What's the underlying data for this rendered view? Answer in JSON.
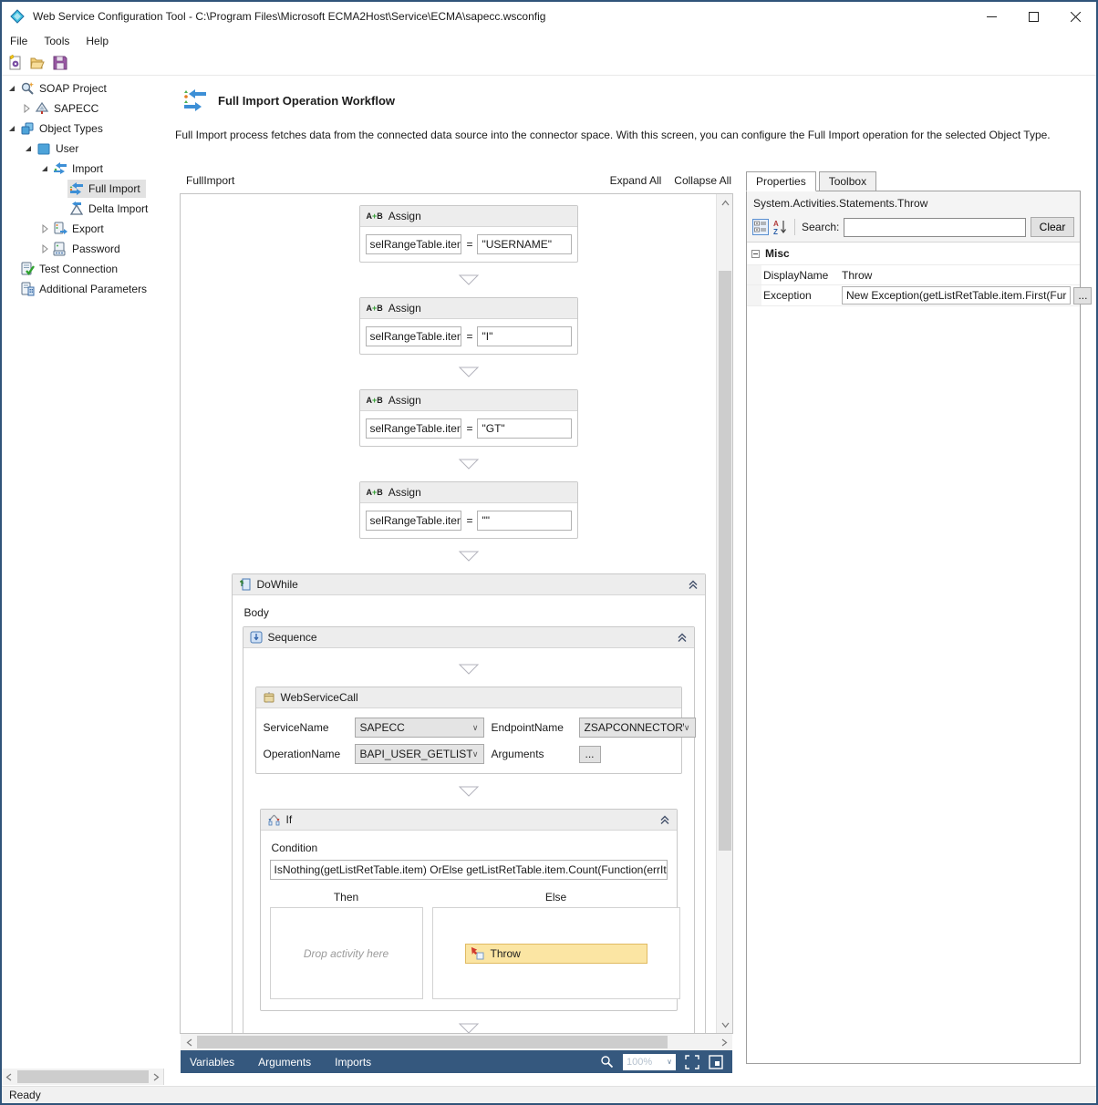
{
  "window": {
    "title": "Web Service Configuration Tool - C:\\Program Files\\Microsoft ECMA2Host\\Service\\ECMA\\sapecc.wsconfig",
    "status": "Ready"
  },
  "menu": {
    "items": [
      "File",
      "Tools",
      "Help"
    ]
  },
  "sidebar": {
    "items": [
      {
        "label": "SOAP Project"
      },
      {
        "label": "SAPECC"
      },
      {
        "label": "Object Types"
      },
      {
        "label": "User"
      },
      {
        "label": "Import"
      },
      {
        "label": "Full Import"
      },
      {
        "label": "Delta Import"
      },
      {
        "label": "Export"
      },
      {
        "label": "Password"
      },
      {
        "label": "Test Connection"
      },
      {
        "label": "Additional Parameters"
      }
    ]
  },
  "header": {
    "title": "Full Import Operation Workflow",
    "description": "Full Import process fetches data from the connected data source into the connector space. With this screen, you can configure the Full Import operation for the selected Object Type."
  },
  "designer": {
    "breadcrumb": "FullImport",
    "expand_all": "Expand All",
    "collapse_all": "Collapse All",
    "assign_title": "Assign",
    "assign_icon_a": "A",
    "assign_icon_plus": "+",
    "assign_icon_b": "B",
    "eq": "=",
    "assigns": [
      {
        "to": "selRangeTable.item",
        "value": "\"USERNAME\""
      },
      {
        "to": "selRangeTable.item",
        "value": "\"I\""
      },
      {
        "to": "selRangeTable.item",
        "value": "\"GT\""
      },
      {
        "to": "selRangeTable.item",
        "value": "\"\""
      }
    ],
    "dowhile": {
      "title": "DoWhile",
      "body_label": "Body"
    },
    "sequence": {
      "title": "Sequence"
    },
    "webservicecall": {
      "title": "WebServiceCall",
      "service_name_label": "ServiceName",
      "service_name": "SAPECC",
      "endpoint_label": "EndpointName",
      "endpoint": "ZSAPCONNECTORWS",
      "operation_label": "OperationName",
      "operation": "BAPI_USER_GETLIST",
      "arguments_label": "Arguments",
      "arguments_button": "..."
    },
    "if": {
      "title": "If",
      "condition_label": "Condition",
      "condition": "IsNothing(getListRetTable.item) OrElse  getListRetTable.item.Count(Function(errItem",
      "then_label": "Then",
      "else_label": "Else",
      "drop_hint": "Drop activity here",
      "throw_label": "Throw"
    },
    "bottom_tabs": [
      "Variables",
      "Arguments",
      "Imports"
    ],
    "zoom_value": "100%"
  },
  "properties": {
    "tabs": [
      "Properties",
      "Toolbox"
    ],
    "type_name": "System.Activities.Statements.Throw",
    "search_label": "Search:",
    "clear_button": "Clear",
    "category": "Misc",
    "rows": [
      {
        "name": "DisplayName",
        "value": "Throw"
      },
      {
        "name": "Exception",
        "value": "New Exception(getListRetTable.item.First(Fur",
        "button": "..."
      }
    ]
  },
  "colors": {
    "accent_bar": "#35587e",
    "throw_fill": "#fbe5a3",
    "throw_border": "#e0ba62",
    "selection": "#e2e2e2"
  }
}
